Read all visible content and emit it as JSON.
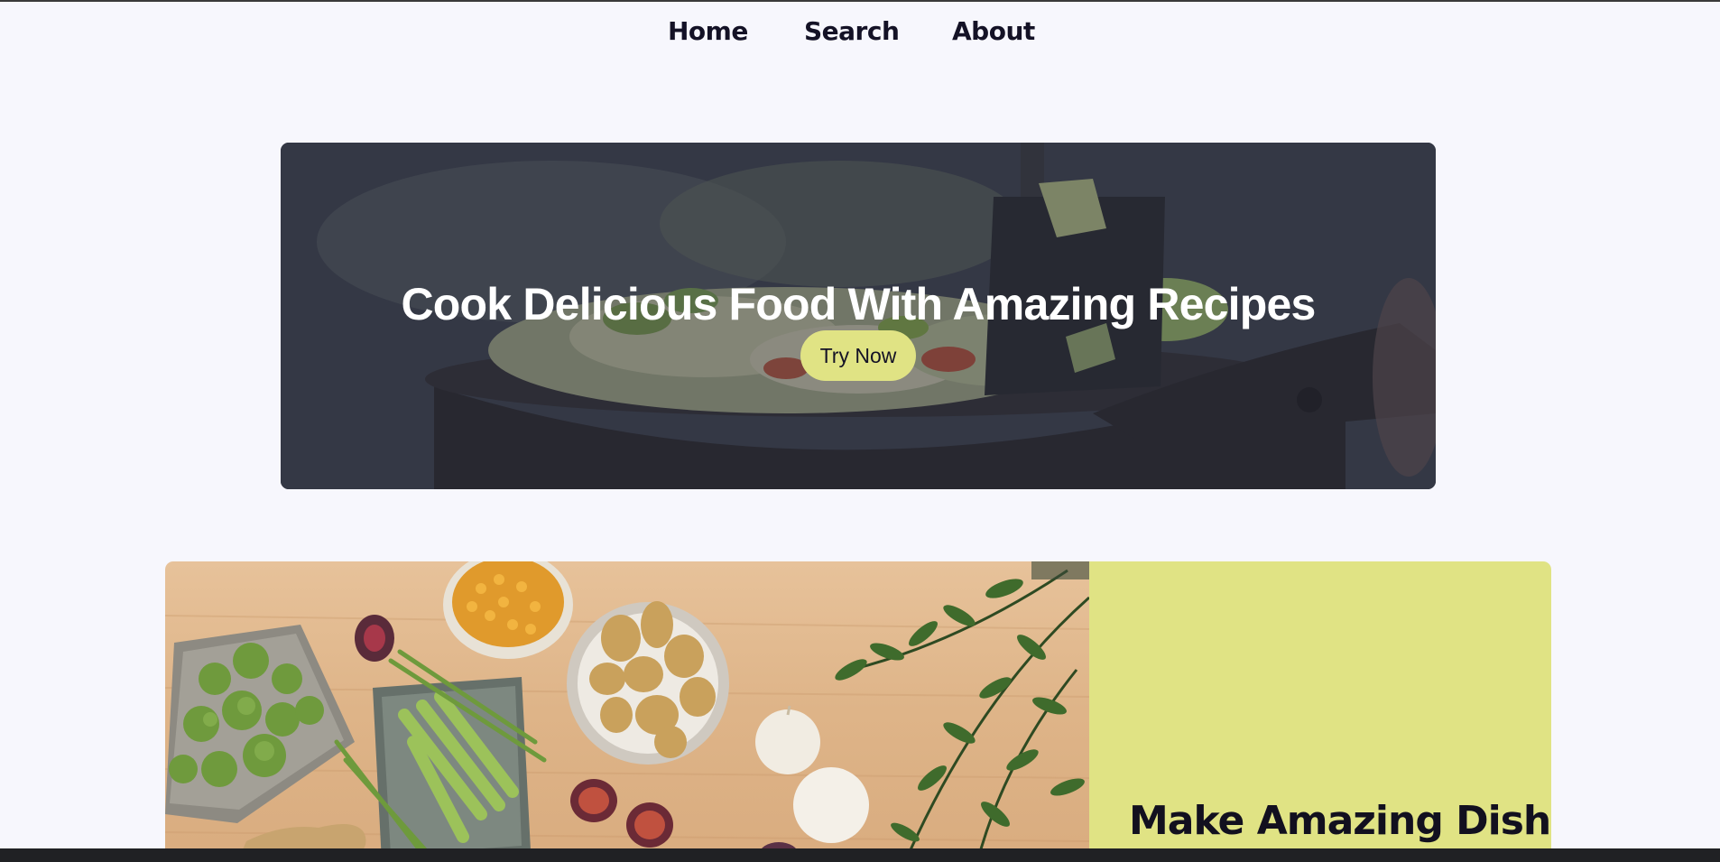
{
  "nav": {
    "home": "Home",
    "search": "Search",
    "about": "About"
  },
  "hero": {
    "title": "Cook Delicious Food With Amazing Recipes",
    "button_label": "Try Now"
  },
  "feature": {
    "heading": "Make Amazing Dishes"
  },
  "colors": {
    "accent": "#e0e384",
    "background": "#f7f7fd",
    "text": "#12101f"
  }
}
